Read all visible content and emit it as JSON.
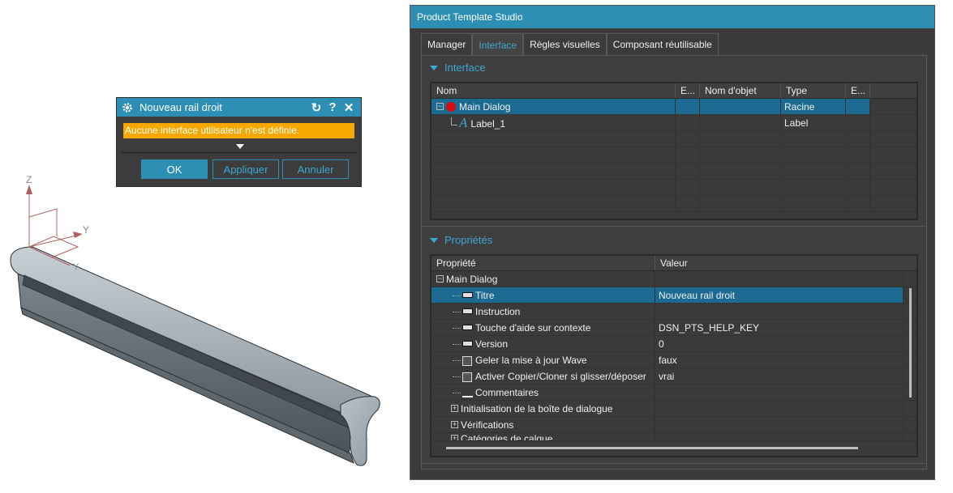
{
  "viewport": {
    "axes": {
      "z": "Z",
      "y1": "Y",
      "y2": "Y"
    }
  },
  "nx_dialog": {
    "title": "Nouveau rail droit",
    "warning": "Aucune interface utilisateur n'est définie.",
    "ok": "OK",
    "apply": "Appliquer",
    "cancel": "Annuler",
    "icons": [
      "gear-icon",
      "reset-icon",
      "help-icon",
      "close-icon",
      "expand-arrow-icon"
    ]
  },
  "studio": {
    "title": "Product Template Studio",
    "tabs": [
      "Manager",
      "Interface",
      "Règles visuelles",
      "Composant réutilisable"
    ],
    "active_tab": "Interface",
    "interface_section": {
      "heading": "Interface",
      "columns": [
        "Nom",
        "E...",
        "Nom d'objet",
        "Type",
        "E..."
      ],
      "rows": [
        {
          "name": "Main Dialog",
          "type": "Racine",
          "selected": true,
          "icon": "red-circle-icon"
        },
        {
          "name": "Label_1",
          "type": "Label",
          "selected": false,
          "icon": "label-A-icon"
        }
      ]
    },
    "properties_section": {
      "heading": "Propriétés",
      "columns": [
        "Propriété",
        "Valeur"
      ],
      "group": "Main Dialog",
      "rows": [
        {
          "name": "Titre",
          "value": "Nouveau rail droit",
          "selected": true
        },
        {
          "name": "Instruction",
          "value": ""
        },
        {
          "name": "Touche d'aide sur contexte",
          "value": "DSN_PTS_HELP_KEY"
        },
        {
          "name": "Version",
          "value": "0"
        },
        {
          "name": "Geler la mise à jour Wave",
          "value": "faux"
        },
        {
          "name": "Activer Copier/Cloner si glisser/déposer",
          "value": "vrai"
        },
        {
          "name": "Commentaires",
          "value": ""
        }
      ],
      "subgroups": [
        "Initialisation de la boîte de dialogue",
        "Vérifications",
        "Catégories de calque"
      ]
    },
    "colors": {
      "accent": "#2e8fb4",
      "selection": "#1c6a92",
      "warning": "#f6a800"
    }
  }
}
